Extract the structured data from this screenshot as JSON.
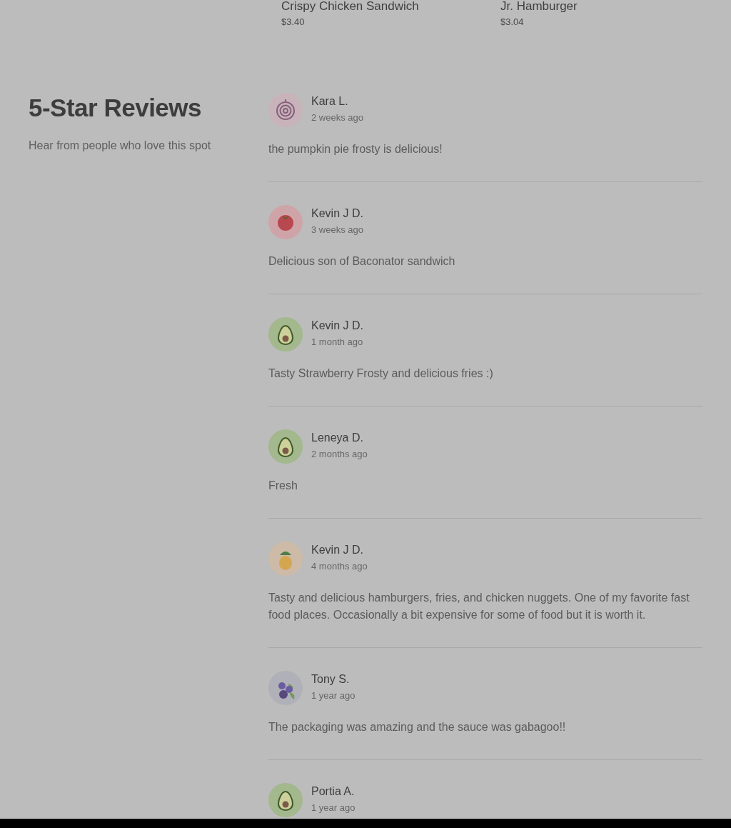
{
  "menu_items": [
    {
      "name": "Crispy Chicken Sandwich",
      "price": "$3.40"
    },
    {
      "name": "Jr. Hamburger",
      "price": "$3.04"
    }
  ],
  "reviews_section": {
    "title": "5-Star Reviews",
    "subtitle": "Hear from people who love this spot"
  },
  "reviews": [
    {
      "kind": "onion",
      "name": "Kara L.",
      "time": "2 weeks ago",
      "text": "the pumpkin pie frosty is delicious!"
    },
    {
      "kind": "tomato",
      "name": "Kevin J D.",
      "time": "3 weeks ago",
      "text": "Delicious son of Baconator sandwich"
    },
    {
      "kind": "avocado",
      "name": "Kevin J D.",
      "time": "1 month ago",
      "text": "Tasty Strawberry Frosty and delicious fries :)"
    },
    {
      "kind": "avocado",
      "name": "Leneya D.",
      "time": "2 months ago",
      "text": "Fresh"
    },
    {
      "kind": "pineapple",
      "name": "Kevin J D.",
      "time": "4 months ago",
      "text": "Tasty and delicious hamburgers, fries, and chicken nuggets. One of my favorite fast food places. Occasionally a bit expensive for some of food but it is worth it."
    },
    {
      "kind": "blueberry",
      "name": "Tony S.",
      "time": "1 year ago",
      "text": "The packaging was amazing and the sauce was gabagoo!!"
    },
    {
      "kind": "avocado",
      "name": "Portia A.",
      "time": "1 year ago"
    }
  ]
}
